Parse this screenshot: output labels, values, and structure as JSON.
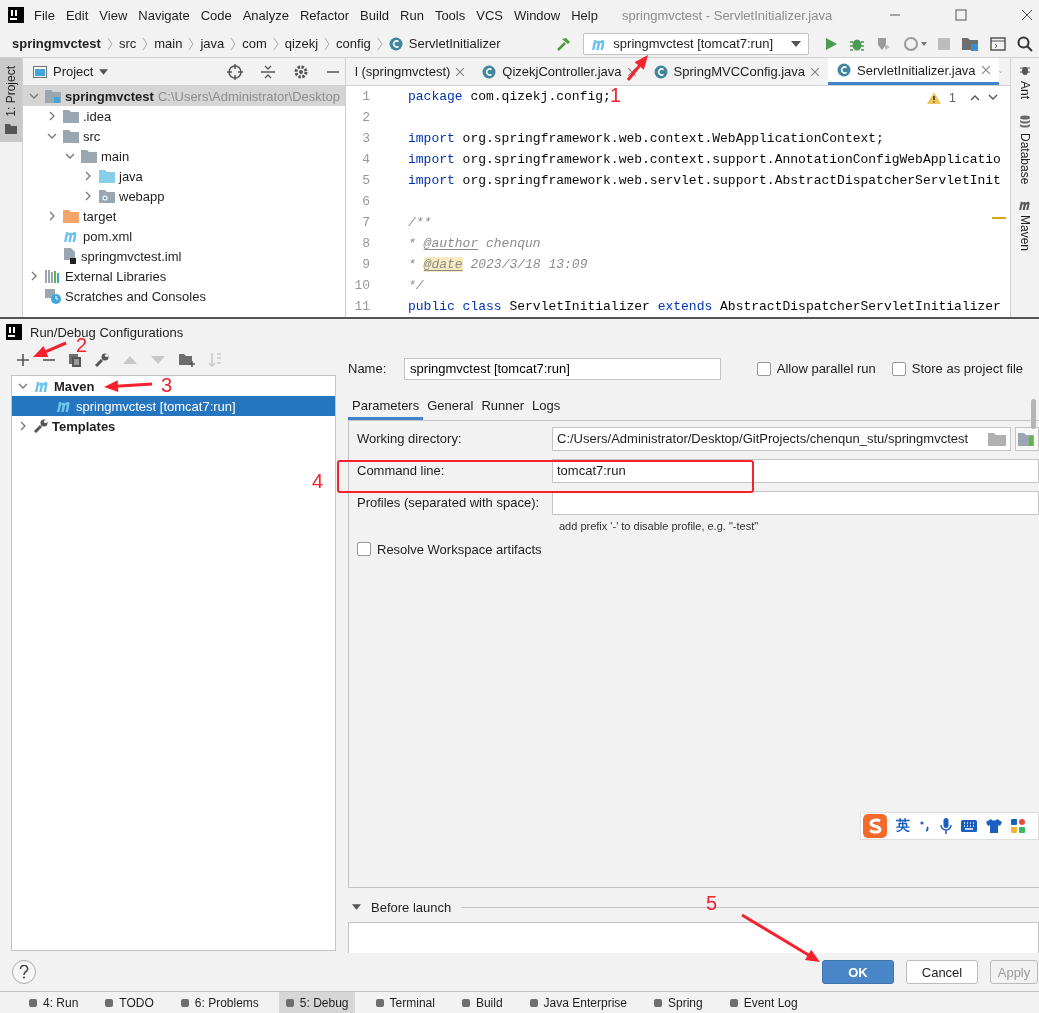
{
  "window": {
    "title": "springmvctest - ServletInitializer.java"
  },
  "menu": [
    "File",
    "Edit",
    "View",
    "Navigate",
    "Code",
    "Analyze",
    "Refactor",
    "Build",
    "Run",
    "Tools",
    "VCS",
    "Window",
    "Help"
  ],
  "breadcrumbs": [
    {
      "label": "springmvctest",
      "kind": "project"
    },
    {
      "label": "src",
      "kind": "dir"
    },
    {
      "label": "main",
      "kind": "dir"
    },
    {
      "label": "java",
      "kind": "dir"
    },
    {
      "label": "com",
      "kind": "dir"
    },
    {
      "label": "qizekj",
      "kind": "dir"
    },
    {
      "label": "config",
      "kind": "dir"
    },
    {
      "label": "ServletInitializer",
      "kind": "class"
    }
  ],
  "run_config": {
    "label": "springmvctest [tomcat7:run]"
  },
  "left_strip": {
    "label": "1: Project",
    "selected": true
  },
  "project_panel": {
    "title": "Project",
    "tree": [
      {
        "label": "springmvctest",
        "hint": "C:\\Users\\Administrator\\Desktop",
        "kind": "module",
        "expanded": true,
        "selected": true,
        "children": [
          {
            "label": ".idea",
            "kind": "folder",
            "expanded": false,
            "selected": false
          },
          {
            "label": "src",
            "kind": "folder",
            "expanded": true,
            "selected": false,
            "children": [
              {
                "label": "main",
                "kind": "folder",
                "expanded": true,
                "selected": false,
                "children": [
                  {
                    "label": "java",
                    "kind": "source",
                    "expanded": false,
                    "selected": false
                  },
                  {
                    "label": "webapp",
                    "kind": "web",
                    "expanded": false,
                    "selected": false
                  }
                ]
              }
            ]
          },
          {
            "label": "target",
            "kind": "excluded",
            "expanded": false,
            "selected": false
          },
          {
            "label": "pom.xml",
            "kind": "maven",
            "selected": false
          },
          {
            "label": "springmvctest.iml",
            "kind": "iml",
            "selected": false
          }
        ]
      },
      {
        "label": "External Libraries",
        "kind": "libraries",
        "expanded": false,
        "selected": false
      },
      {
        "label": "Scratches and Consoles",
        "kind": "scratches",
        "selected": false
      }
    ]
  },
  "editor": {
    "tabs": [
      {
        "label": "l (springmvctest)",
        "kind": "maven",
        "selected": false
      },
      {
        "label": "QizekjController.java",
        "kind": "class",
        "selected": false
      },
      {
        "label": "SpringMVCConfig.java",
        "kind": "class",
        "selected": false
      },
      {
        "label": "ServletInitializer.java",
        "kind": "class",
        "selected": true
      }
    ],
    "warnings": "1",
    "lines": [
      {
        "number": "1",
        "segments": [
          {
            "kind": "keyword",
            "text": "package"
          },
          {
            "kind": "plain",
            "text": " com.qizekj.config;"
          }
        ]
      },
      {
        "number": "2"
      },
      {
        "number": "3",
        "segments": [
          {
            "kind": "keyword",
            "text": "import"
          },
          {
            "kind": "plain",
            "text": " org.springframework.web.context.WebApplicationContext;"
          }
        ]
      },
      {
        "number": "4",
        "segments": [
          {
            "kind": "keyword",
            "text": "import"
          },
          {
            "kind": "plain",
            "text": " org.springframework.web.context.support.AnnotationConfigWebApplicatio"
          }
        ]
      },
      {
        "number": "5",
        "segments": [
          {
            "kind": "keyword",
            "text": "import"
          },
          {
            "kind": "plain",
            "text": " org.springframework.web.servlet.support.AbstractDispatcherServletInit"
          }
        ]
      },
      {
        "number": "6"
      },
      {
        "number": "7",
        "segments": [
          {
            "kind": "comment",
            "text": "/**"
          }
        ]
      },
      {
        "number": "8",
        "segments": [
          {
            "kind": "comment",
            "text": " * "
          },
          {
            "kind": "doctag",
            "text": "@author"
          },
          {
            "kind": "comment",
            "text": " chenqun"
          }
        ]
      },
      {
        "number": "9",
        "segments": [
          {
            "kind": "comment",
            "text": " * "
          },
          {
            "kind": "doctag-marked",
            "text": "@date"
          },
          {
            "kind": "comment",
            "text": " 2023/3/18 13:09"
          }
        ]
      },
      {
        "number": "10",
        "segments": [
          {
            "kind": "comment",
            "text": " */"
          }
        ]
      },
      {
        "number": "11",
        "segments": [
          {
            "kind": "keyword",
            "text": "public class"
          },
          {
            "kind": "plain",
            "text": " ServletInitializer "
          },
          {
            "kind": "keyword",
            "text": "extends"
          },
          {
            "kind": "plain",
            "text": " AbstractDispatcherServletInitializer"
          }
        ]
      }
    ]
  },
  "right_strip": [
    {
      "label": "Ant",
      "kind": "ant"
    },
    {
      "label": "Database",
      "kind": "database"
    },
    {
      "label": "Maven",
      "kind": "maven"
    }
  ],
  "dialog": {
    "title": "Run/Debug Configurations",
    "tree": [
      {
        "label": "Maven",
        "kind": "maven",
        "expanded": true,
        "selected": false,
        "children": [
          {
            "label": "springmvctest [tomcat7:run]",
            "kind": "maven",
            "selected": true
          }
        ]
      },
      {
        "label": "Templates",
        "kind": "wrench",
        "expanded": false,
        "selected": false
      }
    ],
    "name": {
      "label": "Name:",
      "value": "springmvctest [tomcat7:run]"
    },
    "options": [
      {
        "label": "Allow parallel run",
        "checked": false
      },
      {
        "label": "Store as project file",
        "checked": false
      }
    ],
    "tabs": [
      {
        "label": "Parameters",
        "selected": true
      },
      {
        "label": "General",
        "selected": false
      },
      {
        "label": "Runner",
        "selected": false
      },
      {
        "label": "Logs",
        "selected": false
      }
    ],
    "fields": [
      {
        "label": "Working directory:",
        "value": "C:/Users/Administrator/Desktop/GitProjects/chenqun_stu/springmvctest",
        "kind": "browse"
      },
      {
        "label": "Command line:",
        "value": "tomcat7:run",
        "kind": "plain"
      },
      {
        "label": "Profiles (separated with space):",
        "kind": "plain",
        "hint": "add prefix '-' to disable profile, e.g. \"-test\""
      }
    ],
    "resolve": {
      "label": "Resolve Workspace artifacts",
      "checked": false
    },
    "before_launch": {
      "label": "Before launch"
    },
    "buttons": [
      {
        "label": "OK",
        "kind": "primary"
      },
      {
        "label": "Cancel",
        "kind": "normal"
      },
      {
        "label": "Apply",
        "kind": "disabled"
      }
    ]
  },
  "tool_windows": [
    {
      "label": "4: Run",
      "selected": false
    },
    {
      "label": "TODO",
      "selected": false
    },
    {
      "label": "6: Problems",
      "selected": false
    },
    {
      "label": "5: Debug",
      "selected": true
    },
    {
      "label": "Terminal",
      "selected": false
    },
    {
      "label": "Build",
      "selected": false
    },
    {
      "label": "Java Enterprise",
      "selected": false
    },
    {
      "label": "Spring",
      "selected": false
    },
    {
      "label": "Event Log",
      "selected": false
    }
  ],
  "ime_bar": {
    "mode": "英"
  },
  "annotations": [
    "1",
    "2",
    "3",
    "4",
    "5"
  ]
}
